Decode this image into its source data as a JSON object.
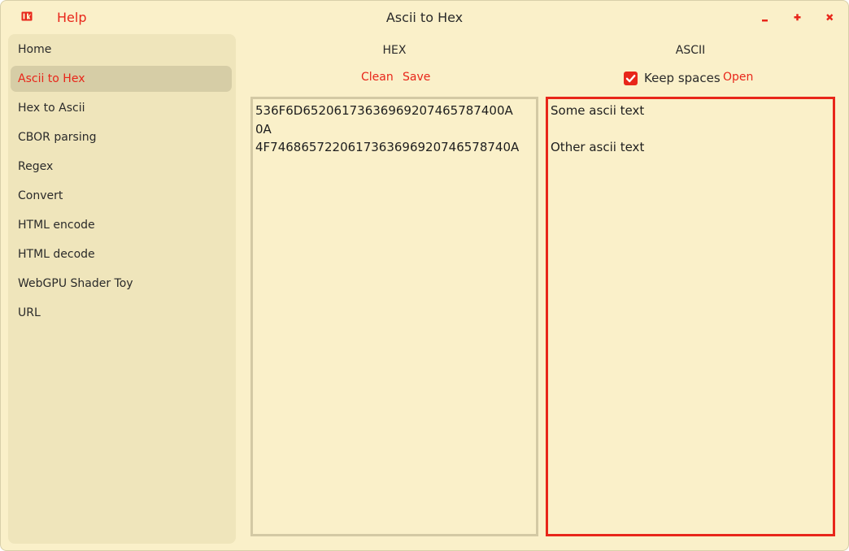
{
  "window": {
    "help_label": "Help",
    "title": "Ascii to Hex",
    "minimize": "–",
    "maximize": "+",
    "close": "×"
  },
  "sidebar": {
    "items": [
      {
        "label": "Home",
        "active": false
      },
      {
        "label": "Ascii to Hex",
        "active": true
      },
      {
        "label": "Hex to Ascii",
        "active": false
      },
      {
        "label": "CBOR parsing",
        "active": false
      },
      {
        "label": "Regex",
        "active": false
      },
      {
        "label": "Convert",
        "active": false
      },
      {
        "label": "HTML encode",
        "active": false
      },
      {
        "label": "HTML decode",
        "active": false
      },
      {
        "label": "WebGPU Shader Toy",
        "active": false
      },
      {
        "label": "URL",
        "active": false
      }
    ]
  },
  "hex": {
    "header": "HEX",
    "clean_label": "Clean",
    "save_label": "Save",
    "content": "536F6D65206173636969207465787400A\n0A\n4F7468657220617363696920746578740A"
  },
  "ascii": {
    "header": "ASCII",
    "keep_spaces_label": "Keep spaces",
    "keep_spaces_checked": true,
    "open_label": "Open",
    "content": "Some ascii text\n\nOther ascii text"
  },
  "colors": {
    "accent": "#e8261a",
    "background": "#faf0c9",
    "sidebar": "#efe5bb",
    "selected": "#d6cda6"
  },
  "icons": {
    "app": "app-logo-icon",
    "check": "checkmark-icon"
  }
}
